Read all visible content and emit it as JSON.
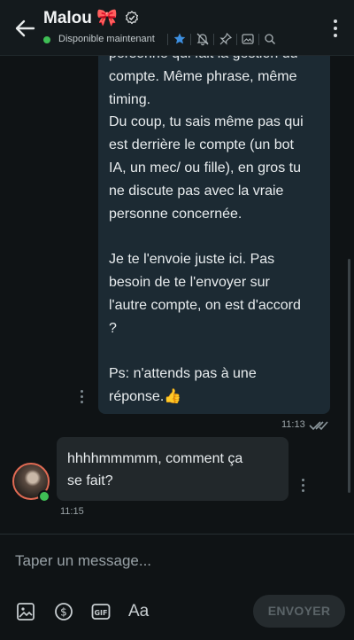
{
  "header": {
    "contact_name": "Malou 🎀",
    "status": "Disponible maintenant",
    "icons": [
      "star-icon",
      "bell-off-icon",
      "pin-icon",
      "image-icon",
      "search-icon"
    ]
  },
  "messages": {
    "outgoing": {
      "lines_p1": [
        "personne qui fait la gestion du",
        "compte. Même phrase, même",
        "timing.",
        "Du coup, tu sais même pas qui",
        "est derrière le compte (un bot",
        "IA, un mec/ ou fille), en gros tu",
        "ne discute pas avec la vraie",
        "personne concernée."
      ],
      "lines_p2": [
        "Je te l'envoie juste ici. Pas",
        "besoin de te l'envoyer sur",
        "l'autre compte, on est d'accord",
        "?"
      ],
      "lines_p3": [
        "Ps: n'attends pas à une",
        "réponse.👍"
      ],
      "time": "11:13"
    },
    "incoming": {
      "lines": [
        "hhhhmmmmm, comment ça",
        "se fait?"
      ],
      "time": "11:15"
    }
  },
  "composer": {
    "placeholder": "Taper un message...",
    "send_label": "ENVOYER",
    "gif_label": "GIF",
    "text_format_label": "Aa"
  },
  "colors": {
    "accent": "#3d8fe0",
    "online": "#3fbf55",
    "outgoing_bubble": "#1c2a33",
    "incoming_bubble": "#22282b"
  }
}
